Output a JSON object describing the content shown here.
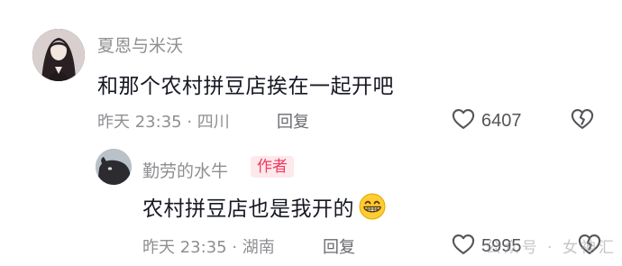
{
  "comments": [
    {
      "username": "夏恩与米沃",
      "content": "和那个农村拼豆店挨在一起开吧",
      "meta": "昨天 23:35 · 四川",
      "reply_label": "回复",
      "like_count": "6407"
    }
  ],
  "reply": {
    "username": "勤劳的水牛",
    "badge": "作者",
    "content": "农村拼豆店也是我开的",
    "emoji": "grinning-face-with-teeth",
    "meta": "昨天 23:35 · 湖南",
    "reply_label": "回复",
    "like_count": "5995"
  },
  "watermark": "公众号 · 女神汇",
  "icons": {
    "like": "heart-outline",
    "dislike": "broken-heart-outline"
  },
  "colors": {
    "text_primary": "#161823",
    "text_secondary": "#8f8f93",
    "badge_bg": "#fde8ec",
    "badge_text": "#f03a5f"
  }
}
